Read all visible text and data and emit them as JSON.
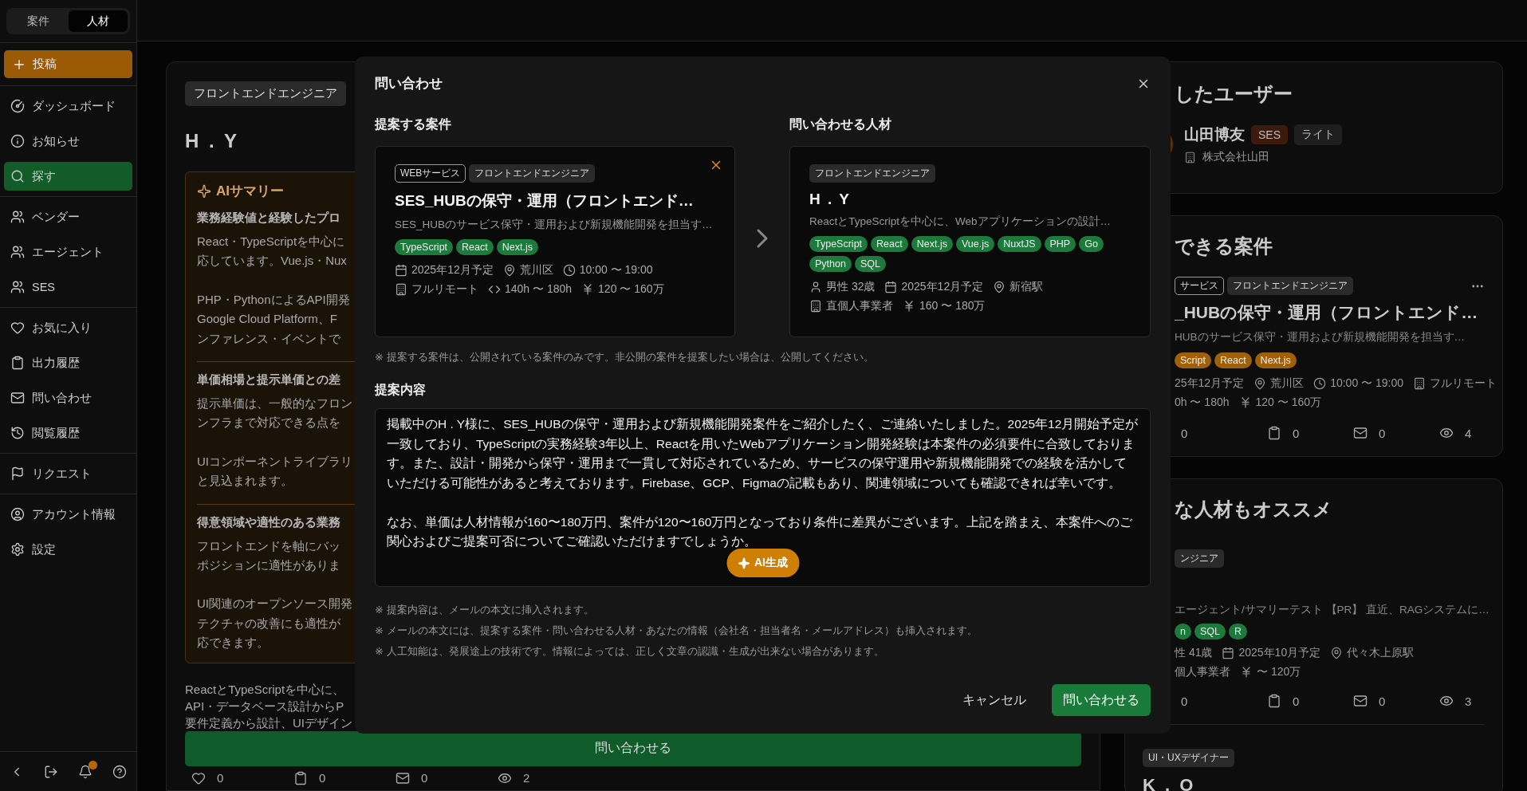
{
  "sidebar": {
    "mode_tabs": [
      {
        "label": "案件",
        "selected": false
      },
      {
        "label": "人材",
        "selected": true
      }
    ],
    "post_button": "投稿",
    "groups": [
      {
        "items": [
          {
            "kind": "dashboard",
            "label": "ダッシュボード",
            "selected": false
          },
          {
            "kind": "news",
            "label": "お知らせ",
            "selected": false
          },
          {
            "kind": "search",
            "label": "探す",
            "selected": true
          }
        ]
      },
      {
        "items": [
          {
            "kind": "vendor",
            "label": "ベンダー",
            "selected": false
          },
          {
            "kind": "agent",
            "label": "エージェント",
            "selected": false
          },
          {
            "kind": "ses",
            "label": "SES",
            "selected": false
          }
        ]
      },
      {
        "items": [
          {
            "kind": "favorites",
            "label": "お気に入り",
            "selected": false
          },
          {
            "kind": "exports",
            "label": "出力履歴",
            "selected": false
          },
          {
            "kind": "inquiries",
            "label": "問い合わせ",
            "selected": false
          },
          {
            "kind": "history",
            "label": "閲覧履歴",
            "selected": false
          }
        ]
      },
      {
        "items": [
          {
            "kind": "requests",
            "label": "リクエスト",
            "selected": false
          }
        ]
      },
      {
        "items": [
          {
            "kind": "account",
            "label": "アカウント情報",
            "selected": false
          },
          {
            "kind": "settings",
            "label": "設定",
            "selected": false
          }
        ]
      }
    ],
    "notification_dot": true
  },
  "profile": {
    "tag": "フロントエンドエンジニア",
    "name": "H . Y",
    "ai_summary": {
      "title": "AIサマリー",
      "sections": [
        {
          "heading": "業務経験値と経験したプロ",
          "paragraphs": [
            [
              "React・TypeScriptを中心に",
              "応しています。Vue.js・Nux"
            ],
            [
              "PHP・PythonによるAPI開発",
              "Google Cloud Platform、F",
              "ンファレンス・イベントで"
            ]
          ]
        },
        {
          "heading": "単価相場と提示単価との差",
          "paragraphs": [
            [
              "提示単価は、一般的なフロン",
              "ンフラまで対応できる点を"
            ],
            [
              "UIコンポーネントライブラリ",
              "と見込まれます。"
            ]
          ]
        },
        {
          "heading": "得意領域や適性のある業務",
          "paragraphs": [
            [
              "フロントエンドを軸にバッ",
              "ポジションに適性がありま"
            ],
            [
              "UI関連のオープンソース開発",
              "テクチャの改善にも適性が",
              "応できます。"
            ]
          ]
        }
      ]
    },
    "description": [
      "ReactとTypeScriptを中心に、",
      "API・データベース設計からP",
      "要件定義から設計、UIデザイン"
    ],
    "contact_button": "問い合わせる",
    "stats": [
      {
        "kind": "likes",
        "value": "0"
      },
      {
        "kind": "saves",
        "value": "0"
      },
      {
        "kind": "messages",
        "value": "0"
      },
      {
        "kind": "views",
        "value": "2"
      }
    ]
  },
  "poster_card": {
    "title": "したユーザー",
    "name": "山田博友",
    "badges": [
      {
        "label": "SES",
        "color": "#3d1a0c"
      },
      {
        "label": "ライト",
        "color": "#1f1f1f"
      }
    ],
    "company": "株式会社山田"
  },
  "projects_card": {
    "title": "できる案件",
    "project": {
      "tags": [
        {
          "label": "サービス",
          "outlined": true
        },
        {
          "label": "フロントエンドエンジニア",
          "outlined": false
        }
      ],
      "title": "_HUBの保守・運用（フロントエンド…",
      "description": "HUBのサービス保守・運用および新規機能開発を担当す…",
      "skills": [
        "Script",
        "React",
        "Next.js"
      ],
      "skills_highlighted": true,
      "meta_rows": [
        [
          {
            "kind": "plain",
            "text": "25年12月予定"
          },
          {
            "kind": "place",
            "text": "荒川区"
          },
          {
            "kind": "time",
            "text": "10:00 〜 19:00"
          },
          {
            "kind": "work",
            "text": "フルリモート"
          }
        ],
        [
          {
            "kind": "plain",
            "text": "0h 〜 180h"
          },
          {
            "kind": "price",
            "text": "120 〜 160万"
          }
        ]
      ],
      "stats": [
        {
          "kind": "plain",
          "value": "0"
        },
        {
          "kind": "saves",
          "value": "0"
        },
        {
          "kind": "messages",
          "value": "0"
        },
        {
          "kind": "views",
          "value": "4"
        }
      ]
    }
  },
  "recommend_card": {
    "title": "な人材もオススメ",
    "talent": {
      "tags": [
        {
          "label": "ンジニア",
          "outlined": false
        }
      ],
      "description": "エージェント/サマリーテスト 【PR】 直近、RAGシステムに…",
      "skills": [
        "n",
        "SQL",
        "R"
      ],
      "skills_highlighted": false,
      "meta_rows": [
        [
          {
            "kind": "plain",
            "text": "性 41歳"
          },
          {
            "kind": "date",
            "text": "2025年10月予定"
          },
          {
            "kind": "place",
            "text": "代々木上原駅"
          }
        ],
        [
          {
            "kind": "plain",
            "text": "個人事業者"
          },
          {
            "kind": "price",
            "text": "〜 120万"
          }
        ]
      ],
      "stats": [
        {
          "kind": "plain",
          "value": "0"
        },
        {
          "kind": "saves",
          "value": "0"
        },
        {
          "kind": "messages",
          "value": "0"
        },
        {
          "kind": "views",
          "value": "3"
        }
      ]
    },
    "next_talent": {
      "tag": "UI・UXデザイナー",
      "name": "K . O"
    }
  },
  "modal": {
    "title": "問い合わせ",
    "project_section": {
      "heading": "提案する案件",
      "card": {
        "tags": [
          {
            "label": "WEBサービス",
            "outlined": true
          },
          {
            "label": "フロントエンドエンジニア",
            "outlined": false
          }
        ],
        "removable": true,
        "title": "SES_HUBの保守・運用（フロントエンド…",
        "description": "SES_HUBのサービス保守・運用および新規機能開発を担当す…",
        "skills": [
          "TypeScript",
          "React",
          "Next.js"
        ],
        "meta_rows": [
          [
            {
              "kind": "date",
              "text": "2025年12月予定"
            },
            {
              "kind": "place",
              "text": "荒川区"
            },
            {
              "kind": "time",
              "text": "10:00 〜 19:00"
            }
          ],
          [
            {
              "kind": "work",
              "text": "フルリモート"
            },
            {
              "kind": "hours",
              "text": "140h 〜 180h"
            },
            {
              "kind": "price",
              "text": "120 〜 160万"
            }
          ]
        ]
      }
    },
    "talent_section": {
      "heading": "問い合わせる人材",
      "card": {
        "tags": [
          {
            "label": "フロントエンドエンジニア",
            "outlined": false
          }
        ],
        "removable": false,
        "title": "H . Y",
        "description": "ReactとTypeScriptを中心に、Webアプリケーションの設計…",
        "skills": [
          "TypeScript",
          "React",
          "Next.js",
          "Vue.js",
          "NuxtJS",
          "PHP",
          "Go",
          "Python",
          "SQL"
        ],
        "meta_rows": [
          [
            {
              "kind": "person",
              "text": "男性 32歳"
            },
            {
              "kind": "date",
              "text": "2025年12月予定"
            },
            {
              "kind": "place",
              "text": "新宿駅"
            }
          ],
          [
            {
              "kind": "work",
              "text": "直個人事業者"
            },
            {
              "kind": "price",
              "text": "160 〜 180万"
            }
          ]
        ]
      }
    },
    "note": "※ 提案する案件は、公開されている案件のみです。非公開の案件を提案したい場合は、公開してください。",
    "message": {
      "heading": "提案内容",
      "paragraphs": [
        "掲載中のH . Y様に、SES_HUBの保守・運用および新規機能開発案件をご紹介したく、ご連絡いたしました。2025年12月開始予定が一致しており、TypeScriptの実務経験3年以上、Reactを用いたWebアプリケーション開発経験は本案件の必須要件に合致しております。また、設計・開発から保守・運用まで一貫して対応されているため、サービスの保守運用や新規機能開発での経験を活かしていただける可能性があると考えております。Firebase、GCP、Figmaの記載もあり、関連領域についても確認できれば幸いです。",
        "なお、単価は人材情報が160〜180万円、案件が120〜160万円となっており条件に差異がございます。上記を踏まえ、本案件へのご関心およびご提案可否についてご確認いただけますでしょうか。"
      ],
      "ai_button": "AI生成"
    },
    "notes": [
      "※ 提案内容は、メールの本文に挿入されます。",
      "※ メールの本文には、提案する案件・問い合わせる人材・あなたの情報（会社名・担当者名・メールアドレス）も挿入されます。",
      "※ 人工知能は、発展途上の技術です。情報によっては、正しく文章の認識・生成が出来ない場合があります。"
    ],
    "cancel_button": "キャンセル",
    "submit_button": "問い合わせる"
  }
}
